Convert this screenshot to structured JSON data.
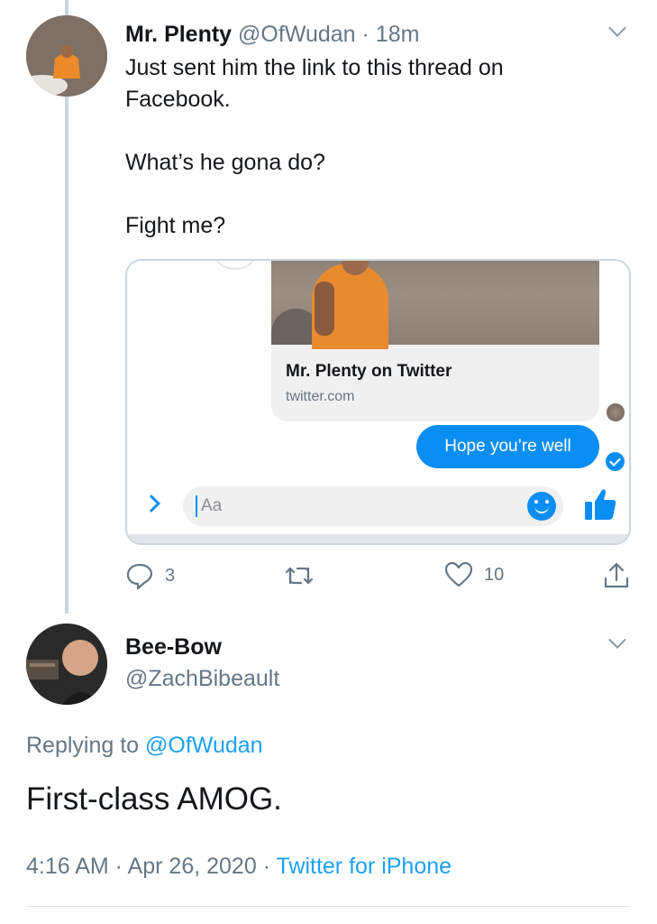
{
  "tweet1": {
    "name": "Mr. Plenty",
    "handle": "@OfWudan",
    "dot": "·",
    "time": "18m",
    "lines": [
      "Just sent him the link to this thread on",
      "Facebook.",
      "What’s he gona do?",
      "Fight me?"
    ],
    "embed": {
      "card_title": "Mr. Plenty on Twitter",
      "card_url": "twitter.com",
      "bubble_text": "Hope you’re well",
      "composer_placeholder": "Aa"
    },
    "actions": {
      "reply_count": "3",
      "retweet_count": "",
      "like_count": "10"
    }
  },
  "tweet2": {
    "name": "Bee-Bow",
    "handle": "@ZachBibeault",
    "replying_prefix": "Replying to ",
    "replying_mention": "@OfWudan",
    "text": "First-class AMOG.",
    "time": "4:16 AM",
    "sep1": " · ",
    "date": "Apr 26, 2020",
    "sep2": " · ",
    "source": "Twitter for iPhone"
  },
  "colors": {
    "accent": "#1da1f2",
    "messenger_blue": "#0a8ef3",
    "muted": "#657786",
    "text": "#14171a"
  },
  "icons": [
    "chevron-down-icon",
    "reply-icon",
    "retweet-icon",
    "like-icon",
    "share-icon",
    "smile-icon",
    "thumbs-up-icon",
    "chevron-right-icon",
    "seen-check-icon"
  ]
}
